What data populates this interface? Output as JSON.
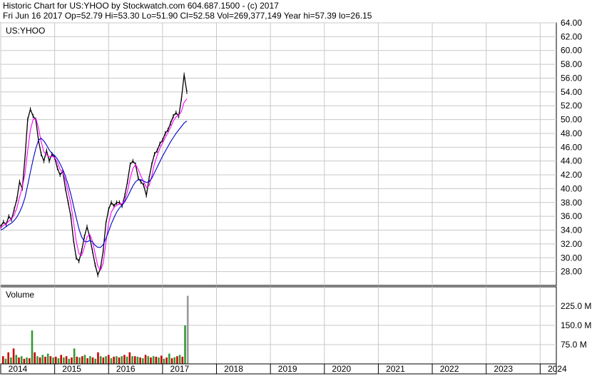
{
  "header": {
    "title_line": "Historic Chart for US:YHOO by Stockwatch.com 604.687.1500 - (c) 2017",
    "stats_line": "Fri Jun 16 2017   Op=52.79   Hi=53.30   Lo=51.90   Cl=52.58   Vol=269,377,149   Year hi=57.39   lo=26.15"
  },
  "chart_data": [
    {
      "type": "line",
      "title": "US:YHOO",
      "ylim": [
        26,
        64
      ],
      "y_ticks": [
        "64.00",
        "62.00",
        "60.00",
        "58.00",
        "56.00",
        "54.00",
        "52.00",
        "50.00",
        "48.00",
        "46.00",
        "44.00",
        "42.00",
        "40.00",
        "38.00",
        "36.00",
        "34.00",
        "32.00",
        "30.00",
        "28.00"
      ],
      "x": [
        2014.0,
        2014.05,
        2014.1,
        2014.15,
        2014.2,
        2014.25,
        2014.3,
        2014.35,
        2014.4,
        2014.45,
        2014.5,
        2014.55,
        2014.6,
        2014.65,
        2014.7,
        2014.75,
        2014.8,
        2014.85,
        2014.9,
        2014.95,
        2015.0,
        2015.05,
        2015.1,
        2015.15,
        2015.2,
        2015.25,
        2015.3,
        2015.35,
        2015.4,
        2015.45,
        2015.5,
        2015.55,
        2015.6,
        2015.65,
        2015.7,
        2015.75,
        2015.8,
        2015.85,
        2015.9,
        2015.95,
        2016.0,
        2016.05,
        2016.1,
        2016.15,
        2016.2,
        2016.25,
        2016.3,
        2016.35,
        2016.4,
        2016.45,
        2016.5,
        2016.55,
        2016.6,
        2016.65,
        2016.7,
        2016.75,
        2016.8,
        2016.85,
        2016.9,
        2016.95,
        2017.0,
        2017.05,
        2017.1,
        2017.15,
        2017.2,
        2017.25,
        2017.3,
        2017.35,
        2017.4,
        2017.45
      ],
      "series": [
        {
          "color": "#000000",
          "values": [
            34.5,
            35.2,
            34.8,
            36.0,
            35.5,
            37.0,
            38.5,
            41.0,
            40.0,
            44.5,
            50.0,
            51.5,
            50.5,
            50.0,
            47.0,
            45.0,
            44.0,
            45.5,
            44.0,
            45.0,
            44.5,
            43.0,
            42.0,
            42.5,
            40.0,
            38.0,
            36.0,
            32.5,
            30.0,
            29.5,
            31.0,
            33.0,
            34.5,
            33.0,
            31.0,
            29.0,
            27.5,
            28.5,
            31.0,
            35.0,
            37.0,
            38.0,
            37.5,
            38.0,
            38.0,
            37.5,
            39.0,
            41.0,
            43.5,
            44.0,
            43.5,
            41.5,
            41.0,
            40.5,
            39.0,
            41.5,
            43.5,
            45.0,
            45.5,
            46.5,
            47.0,
            48.0,
            48.5,
            49.5,
            50.5,
            51.0,
            50.5,
            53.0,
            56.5,
            54.0
          ]
        },
        {
          "color": "#ff00ff",
          "values": [
            34.3,
            34.7,
            34.9,
            35.3,
            35.6,
            36.2,
            37.2,
            38.8,
            40.2,
            42.2,
            45.5,
            48.5,
            50.0,
            50.2,
            48.8,
            46.8,
            45.3,
            44.9,
            44.6,
            44.7,
            44.5,
            43.8,
            42.8,
            42.4,
            41.2,
            39.6,
            37.8,
            35.2,
            32.4,
            30.6,
            30.3,
            31.5,
            33.0,
            33.4,
            32.4,
            30.6,
            28.8,
            28.2,
            29.2,
            32.2,
            35.0,
            36.6,
            37.3,
            37.6,
            37.8,
            37.8,
            38.3,
            39.6,
            41.5,
            42.9,
            43.5,
            42.8,
            41.8,
            41.0,
            40.2,
            40.4,
            41.8,
            43.6,
            44.8,
            45.8,
            46.6,
            47.4,
            48.1,
            48.9,
            49.8,
            50.4,
            50.6,
            51.2,
            52.5,
            53.0
          ]
        },
        {
          "color": "#0000cc",
          "values": [
            34.0,
            34.2,
            34.5,
            34.8,
            35.0,
            35.4,
            35.9,
            36.6,
            37.5,
            38.7,
            40.5,
            42.4,
            44.2,
            45.8,
            47.0,
            47.3,
            46.9,
            46.3,
            45.6,
            45.1,
            44.8,
            44.3,
            43.6,
            42.8,
            41.8,
            40.6,
            39.2,
            37.5,
            35.8,
            34.2,
            33.0,
            32.4,
            32.3,
            32.5,
            32.3,
            31.8,
            31.5,
            31.5,
            31.9,
            32.8,
            33.8,
            34.9,
            35.8,
            36.6,
            37.2,
            37.6,
            38.1,
            38.8,
            39.6,
            40.4,
            41.0,
            41.3,
            41.3,
            41.1,
            40.9,
            41.0,
            41.5,
            42.3,
            43.1,
            43.9,
            44.7,
            45.4,
            46.1,
            46.8,
            47.4,
            48.0,
            48.5,
            49.0,
            49.5,
            49.8
          ]
        }
      ]
    },
    {
      "type": "bar",
      "title": "Volume",
      "ylim": [
        0,
        300
      ],
      "y_ticks": [
        "225.0 M",
        "150.0 M",
        "75.0 M"
      ],
      "values": [
        30,
        20,
        45,
        25,
        60,
        35,
        25,
        30,
        20,
        25,
        22,
        130,
        45,
        30,
        25,
        35,
        28,
        40,
        30,
        25,
        28,
        22,
        35,
        25,
        30,
        20,
        25,
        60,
        28,
        25,
        30,
        35,
        22,
        30,
        25,
        20,
        45,
        30,
        25,
        30,
        35,
        22,
        28,
        30,
        25,
        30,
        35,
        28,
        45,
        30,
        30,
        28,
        25,
        22,
        35,
        30,
        25,
        30,
        28,
        25,
        32,
        20,
        25,
        40,
        22,
        26,
        30,
        35,
        28,
        150,
        265
      ]
    }
  ],
  "x_axis": {
    "labels": [
      "2014",
      "2015",
      "2016",
      "2017",
      "2018",
      "2019",
      "2020",
      "2021",
      "2022",
      "2023",
      "2024"
    ]
  }
}
